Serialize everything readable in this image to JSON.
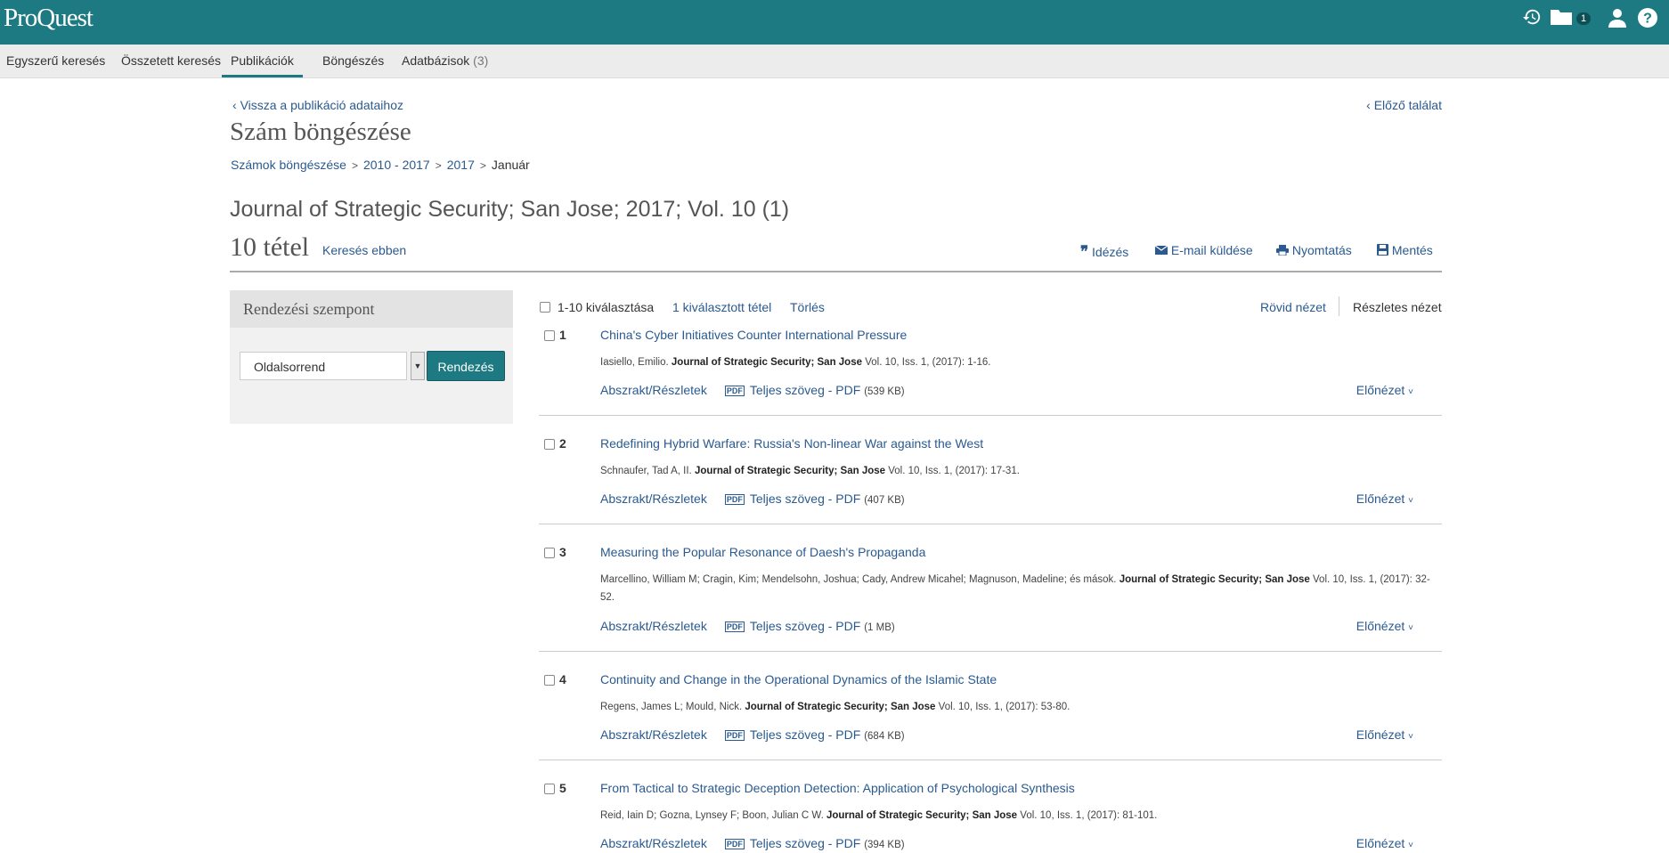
{
  "app": {
    "logo": "ProQuest",
    "folder_count": "1"
  },
  "nav": [
    {
      "label": "Egyszerű keresés"
    },
    {
      "label": "Összetett keresés"
    },
    {
      "label": "Publikációk"
    },
    {
      "label": "Böngészés"
    },
    {
      "label": "Adatbázisok",
      "count": "(3)"
    }
  ],
  "back_link": "Vissza a publikáció adataihoz",
  "prev_link": "Előző találat",
  "page_title": "Szám böngészése",
  "breadcrumb": [
    "Számok böngészése",
    "2010 - 2017",
    "2017",
    "Január"
  ],
  "journal_title": "Journal of Strategic Security; San Jose; 2017; Vol. 10 (1)",
  "count": "10 tétel",
  "search_within": "Keresés ebben",
  "toolbar": {
    "cite": "Idézés",
    "email": "E-mail küldése",
    "print": "Nyomtatás",
    "save": "Mentés"
  },
  "sort": {
    "heading": "Rendezési szempont",
    "selected": "Oldalsorrend",
    "button": "Rendezés"
  },
  "results_bar": {
    "select_all": "1-10 kiválasztása",
    "selected": "1 kiválasztott tétel",
    "clear": "Törlés",
    "short_view": "Rövid nézet",
    "detailed_view": "Részletes nézet"
  },
  "labels": {
    "abstract": "Abszrakt/Részletek",
    "fulltext": "Teljes szöveg - PDF",
    "preview": "Előnézet"
  },
  "items": [
    {
      "num": "1",
      "title": "China's Cyber Initiatives Counter International Pressure",
      "authors": "Iasiello, Emilio.",
      "source": "Journal of Strategic Security; San Jose",
      "rest": "Vol. 10, Iss. 1,  (2017): 1-16.",
      "size": "(539 KB)"
    },
    {
      "num": "2",
      "title": "Redefining Hybrid Warfare: Russia's Non-linear War against the West",
      "authors": "Schnaufer, Tad A, II.",
      "source": "Journal of Strategic Security; San Jose",
      "rest": "Vol. 10, Iss. 1,  (2017): 17-31.",
      "size": "(407 KB)"
    },
    {
      "num": "3",
      "title": "Measuring the Popular Resonance of Daesh's Propaganda",
      "authors": "Marcellino, William M; Cragin, Kim; Mendelsohn, Joshua; Cady, Andrew Micahel; Magnuson, Madeline; és mások.",
      "source": "Journal of Strategic Security; San Jose",
      "rest": "Vol. 10, Iss. 1,  (2017): 32-52.",
      "size": "(1 MB)"
    },
    {
      "num": "4",
      "title": "Continuity and Change in the Operational Dynamics of the Islamic State",
      "authors": "Regens, James L; Mould, Nick.",
      "source": "Journal of Strategic Security; San Jose",
      "rest": "Vol. 10, Iss. 1,  (2017): 53-80.",
      "size": "(684 KB)"
    },
    {
      "num": "5",
      "title": "From Tactical to Strategic Deception Detection: Application of Psychological Synthesis",
      "authors": "Reid, Iain D; Gozna, Lynsey F; Boon, Julian C W.",
      "source": "Journal of Strategic Security; San Jose",
      "rest": "Vol. 10, Iss. 1,  (2017): 81-101.",
      "size": "(394 KB)"
    }
  ]
}
